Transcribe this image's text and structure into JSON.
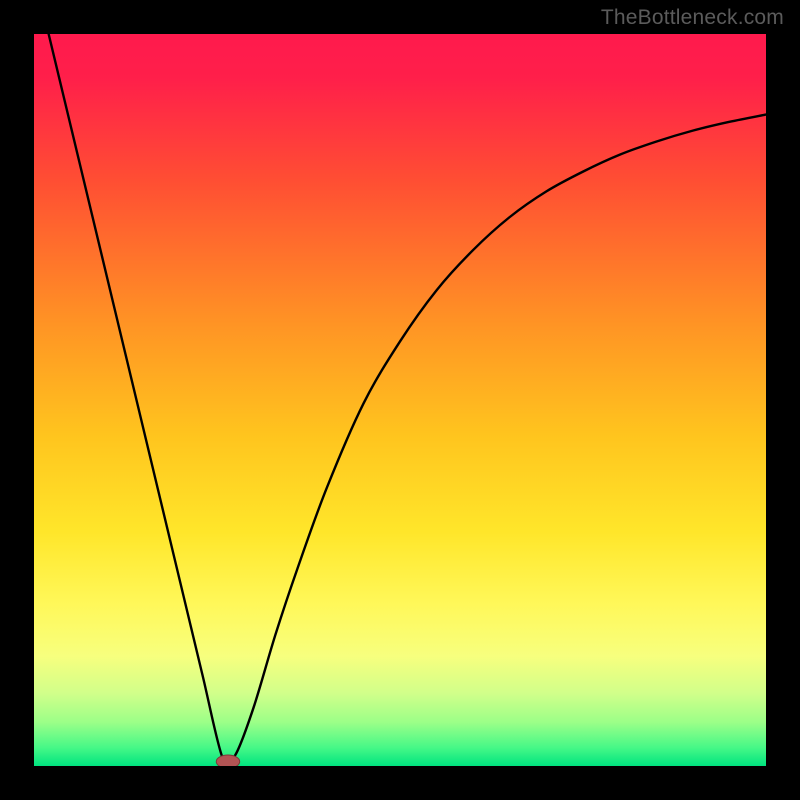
{
  "watermark": "TheBottleneck.com",
  "chart_data": {
    "type": "line",
    "title": "",
    "xlabel": "",
    "ylabel": "",
    "xlim": [
      0,
      100
    ],
    "ylim": [
      0,
      100
    ],
    "grid": false,
    "background": {
      "gradient_stops": [
        {
          "pos": 0.0,
          "color": "#ff1a4d"
        },
        {
          "pos": 0.06,
          "color": "#ff1f4a"
        },
        {
          "pos": 0.2,
          "color": "#ff4e33"
        },
        {
          "pos": 0.4,
          "color": "#ff9524"
        },
        {
          "pos": 0.55,
          "color": "#ffc51e"
        },
        {
          "pos": 0.68,
          "color": "#ffe62a"
        },
        {
          "pos": 0.78,
          "color": "#fff85a"
        },
        {
          "pos": 0.85,
          "color": "#f7ff7e"
        },
        {
          "pos": 0.9,
          "color": "#d2ff8a"
        },
        {
          "pos": 0.94,
          "color": "#9cff88"
        },
        {
          "pos": 0.975,
          "color": "#46f887"
        },
        {
          "pos": 1.0,
          "color": "#00e47f"
        }
      ]
    },
    "series": [
      {
        "name": "bottleneck-curve",
        "color": "#000000",
        "width": 2.4,
        "x": [
          2.0,
          5,
          8,
          11,
          14,
          17,
          20,
          23,
          25.8,
          27.5,
          30,
          33,
          36,
          40,
          45,
          50,
          55,
          60,
          65,
          70,
          75,
          80,
          85,
          90,
          95,
          100
        ],
        "y": [
          100,
          87.5,
          75,
          62.5,
          50,
          37.5,
          25,
          12.5,
          1.0,
          1.5,
          8,
          18,
          27,
          38,
          49.5,
          58,
          65,
          70.5,
          75,
          78.5,
          81.2,
          83.5,
          85.3,
          86.8,
          88,
          89
        ]
      }
    ],
    "marker": {
      "name": "min-point",
      "x": 26.5,
      "y": 0.6,
      "rx_pct": 1.6,
      "ry_pct": 0.9,
      "fill": "#b25454",
      "stroke": "#7a3a3a"
    }
  }
}
